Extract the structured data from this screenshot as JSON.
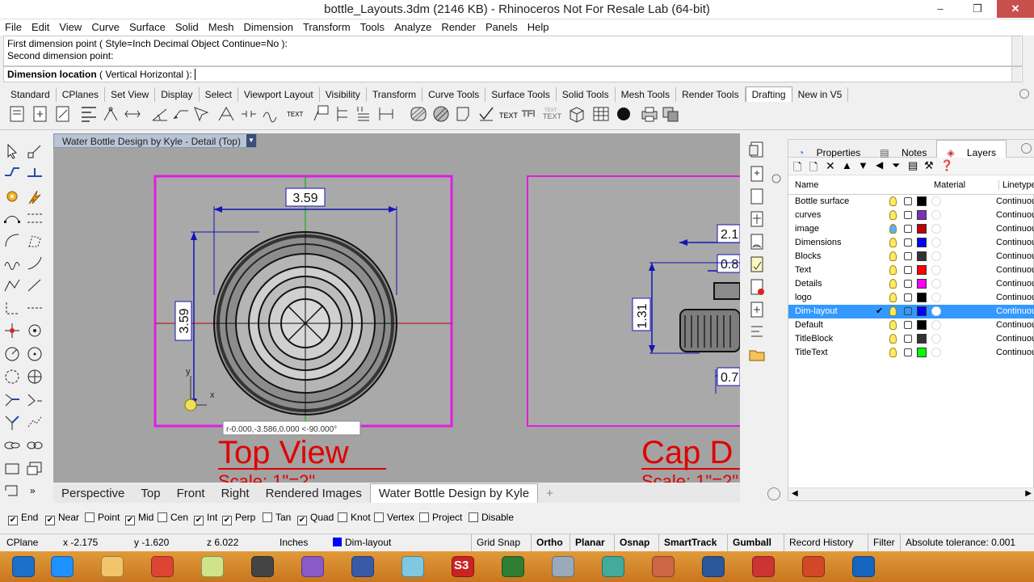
{
  "window": {
    "title": "bottle_Layouts.3dm (2146 KB) - Rhinoceros Not For Resale Lab (64-bit)",
    "minimize": "–",
    "restore": "❐",
    "close": "✕"
  },
  "menu": [
    "File",
    "Edit",
    "View",
    "Curve",
    "Surface",
    "Solid",
    "Mesh",
    "Dimension",
    "Transform",
    "Tools",
    "Analyze",
    "Render",
    "Panels",
    "Help"
  ],
  "command": {
    "history_line1": "First dimension point ( Style=Inch Decimal  Object  Continue=No ):",
    "history_line2": "Second dimension point:",
    "prompt_bold": "Dimension location",
    "prompt_rest": " ( Vertical  Horizontal ):"
  },
  "toolbar_tabs": [
    "Standard",
    "CPlanes",
    "Set View",
    "Display",
    "Select",
    "Viewport Layout",
    "Visibility",
    "Transform",
    "Curve Tools",
    "Surface Tools",
    "Solid Tools",
    "Mesh Tools",
    "Render Tools",
    "Drafting",
    "New in V5"
  ],
  "toolbar_active": "Drafting",
  "toolbar_icons": [
    "linear-dimension-icon",
    "aligned-dimension-icon",
    "rotated-dimension-icon",
    "ordinate-dimension-icon",
    "radius-dimension-icon",
    "diameter-dimension-icon",
    "angle-dimension-icon",
    "leader-icon",
    "text-icon",
    "text-block-icon",
    "hatch-icon",
    "text-object-icon",
    "printer-icon",
    "block-icon"
  ],
  "viewport": {
    "title": "Water Bottle Design by Kyle - Detail (Top)",
    "dim_horizontal": "3.59",
    "dim_vertical": "3.59",
    "dim_right_1": "2.1",
    "dim_right_2": "0.8",
    "dim_right_3": "1.31",
    "dim_right_4": "0.7",
    "axis_y": "y",
    "axis_x": "x",
    "tooltip": "r-0.000,-3.586,0.000   <-90.000°",
    "label_top": "Top View",
    "label_top_scale": "Scale: 1\"=2\"",
    "label_cap": "Cap D",
    "label_cap_scale": "Scale: 1\"=2\""
  },
  "viewport_tabs": [
    "Perspective",
    "Top",
    "Front",
    "Right",
    "Rendered Images",
    "Water Bottle Design by Kyle"
  ],
  "viewport_tab_active": "Water Bottle Design by Kyle",
  "viewport_tab_add": "+",
  "panel": {
    "tabs": [
      "Properties",
      "Notes",
      "Layers"
    ],
    "active": "Layers",
    "columns": {
      "name": "Name",
      "material": "Material",
      "linetype": "Linetype"
    },
    "layers": [
      {
        "name": "Bottle surface",
        "color": "#000000",
        "linetype": "Continuous"
      },
      {
        "name": "curves",
        "color": "#7b2fbe",
        "linetype": "Continuous"
      },
      {
        "name": "image",
        "color": "#c00000",
        "linetype": "Continuous"
      },
      {
        "name": "Dimensions",
        "color": "#0000ff",
        "linetype": "Continuous"
      },
      {
        "name": "Blocks",
        "color": "#333333",
        "linetype": "Continuous"
      },
      {
        "name": "Text",
        "color": "#ff0000",
        "linetype": "Continuous"
      },
      {
        "name": "Details",
        "color": "#ff00ff",
        "linetype": "Continuous"
      },
      {
        "name": "logo",
        "color": "#000000",
        "linetype": "Continuous"
      },
      {
        "name": "Dim-layout",
        "color": "#0000ff",
        "linetype": "Continuous",
        "current": true
      },
      {
        "name": "Default",
        "color": "#000000",
        "linetype": "Continuous"
      },
      {
        "name": "TitleBlock",
        "color": "#333333",
        "linetype": "Continuous"
      },
      {
        "name": "TitleText",
        "color": "#00ff00",
        "linetype": "Continuous"
      }
    ],
    "current_mark": "✔"
  },
  "osnap": [
    {
      "label": "End",
      "checked": true
    },
    {
      "label": "Near",
      "checked": true
    },
    {
      "label": "Point",
      "checked": false
    },
    {
      "label": "Mid",
      "checked": true
    },
    {
      "label": "Cen",
      "checked": false
    },
    {
      "label": "Int",
      "checked": true
    },
    {
      "label": "Perp",
      "checked": true
    },
    {
      "label": "Tan",
      "checked": false
    },
    {
      "label": "Quad",
      "checked": true
    },
    {
      "label": "Knot",
      "checked": false
    },
    {
      "label": "Vertex",
      "checked": false
    },
    {
      "label": "Project",
      "checked": false
    },
    {
      "label": "Disable",
      "checked": false
    }
  ],
  "status": {
    "cplane": "CPlane",
    "x": "x -2.175",
    "y": "y -1.620",
    "z": "z 6.022",
    "units": "Inches",
    "layer": "Dim-layout",
    "grid_snap": "Grid Snap",
    "ortho": "Ortho",
    "planar": "Planar",
    "osnap": "Osnap",
    "smarttrack": "SmartTrack",
    "gumball": "Gumball",
    "record_history": "Record History",
    "filter": "Filter",
    "tolerance": "Absolute tolerance: 0.001"
  },
  "taskbar_icons": [
    "windows-start-icon",
    "internet-explorer-icon",
    "file-explorer-icon",
    "chrome-icon",
    "notes-icon",
    "rhino-icon",
    "photo-app-icon",
    "film-icon",
    "paper-icon",
    "s3-app-icon",
    "xbox-icon",
    "monitor-icon",
    "network-icon",
    "audio-icon",
    "word-icon",
    "pdf-icon",
    "powerpoint-icon",
    "snowflake-icon"
  ],
  "taskbar_s3": "S3",
  "colors": {
    "magenta_frame": "#e11ee1",
    "dim_blue": "#1414b4",
    "red_label": "#e00000",
    "selection": "#3399ff"
  }
}
